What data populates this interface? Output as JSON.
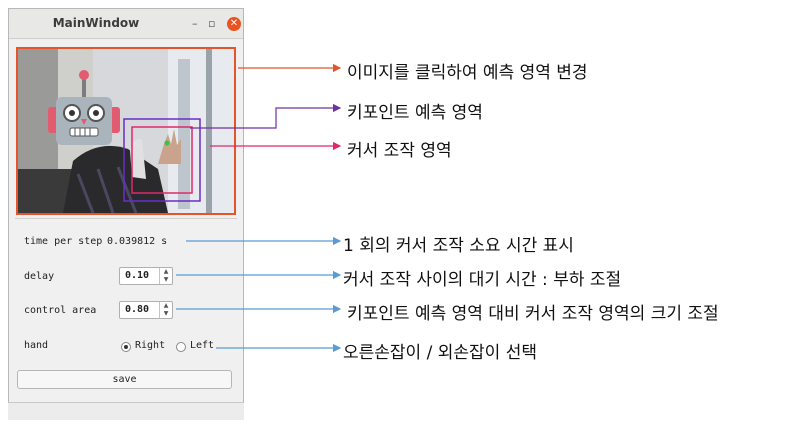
{
  "window": {
    "title": "MainWindow",
    "min_glyph": "–",
    "max_glyph": "▫",
    "close_glyph": "✕"
  },
  "camera": {
    "description_icon": "robot-face-icon"
  },
  "fields": {
    "time_label": "time per step",
    "time_value": "0.039812 s",
    "delay_label": "delay",
    "delay_value": "0.10",
    "control_area_label": "control area",
    "control_area_value": "0.80",
    "hand_label": "hand",
    "hand_right": "Right",
    "hand_left": "Left",
    "hand_selected": "Right"
  },
  "save_label": "save",
  "annotations": [
    {
      "text": "이미지를 클릭하여 예측 영역 변경",
      "color": "#e4552d"
    },
    {
      "text": "키포인트 예측 영역",
      "color": "#7030a0"
    },
    {
      "text": "커서 조작 영역",
      "color": "#e0286e"
    },
    {
      "text": "1 회의 커서 조작 소요 시간 표시",
      "color": "#5b9bd5"
    },
    {
      "text": "커서 조작 사이의 대기 시간 :  부하 조절",
      "color": "#5b9bd5"
    },
    {
      "text": "키포인트 예측 영역 대비 커서 조작 영역의 크기 조절",
      "color": "#5b9bd5"
    },
    {
      "text": "오른손잡이  /  외손잡이 선택",
      "color": "#5b9bd5"
    }
  ]
}
